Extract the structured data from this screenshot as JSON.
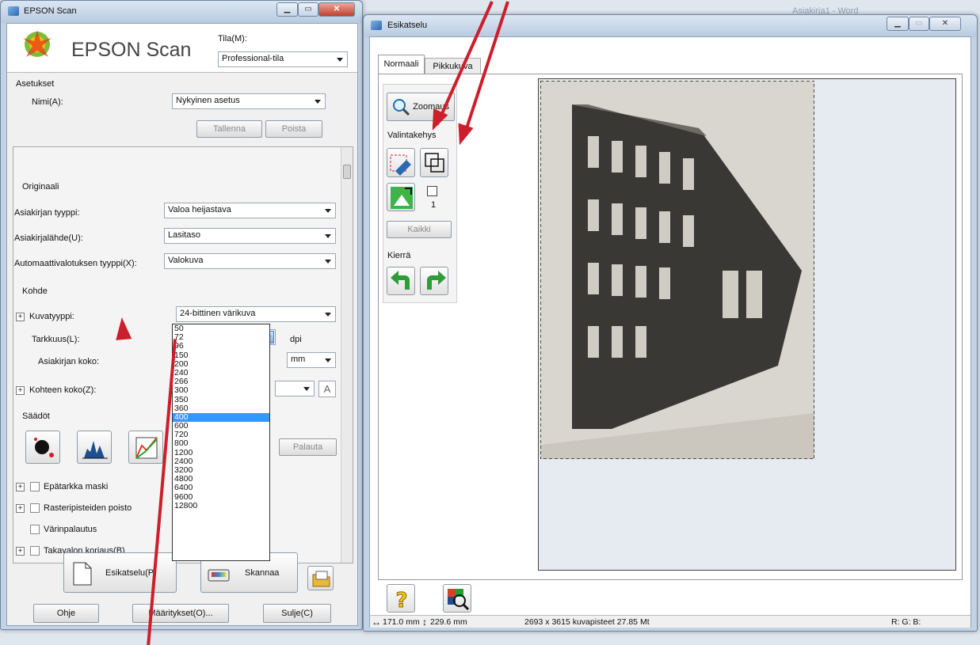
{
  "scan_window": {
    "title": "EPSON Scan",
    "brand": "EPSON Scan",
    "mode_label": "Tila(M):",
    "mode_value": "Professional-tila",
    "settings_group": "Asetukset",
    "name_label": "Nimi(A):",
    "name_value": "Nykyinen asetus",
    "save_button": "Tallenna",
    "delete_button": "Poista",
    "original_heading": "Originaali",
    "doc_type_label": "Asiakirjan tyyppi:",
    "doc_type_value": "Valoa heijastava",
    "doc_source_label": "Asiakirjalähde(U):",
    "doc_source_value": "Lasitaso",
    "auto_exposure_label": "Automaattivalotuksen tyyppi(X):",
    "auto_exposure_value": "Valokuva",
    "target_heading": "Kohde",
    "image_type_label": "Kuvatyyppi:",
    "image_type_value": "24-bittinen värikuva",
    "resolution_label": "Tarkkuus(L):",
    "resolution_value": "400",
    "dpi_unit": "dpi",
    "doc_size_label": "Asiakirjan koko:",
    "unit_value": "mm",
    "target_size_label": "Kohteen koko(Z):",
    "adjustments_heading": "Säädöt",
    "reset_button": "Palauta",
    "unsharp_label": "Epätarkka maski",
    "descreen_label": "Rasteripisteiden poisto",
    "color_restore_label": "Värinpalautus",
    "backlight_label": "Takavalon korjaus(B)",
    "preview_button": "Esikatselu(P)",
    "scan_button": "Skannaa",
    "help_button": "Ohje",
    "config_button": "Määritykset(O)...",
    "close_button": "Sulje(C)",
    "resolution_options": [
      "50",
      "72",
      "96",
      "150",
      "200",
      "240",
      "266",
      "300",
      "350",
      "360",
      "400",
      "600",
      "720",
      "800",
      "1200",
      "2400",
      "3200",
      "4800",
      "6400",
      "9600",
      "12800"
    ],
    "resolution_selected": "400"
  },
  "preview_window": {
    "title": "Esikatselu",
    "tab_normal": "Normaali",
    "tab_thumbnail": "Pikkukuva",
    "zoom_button": "Zoomaus",
    "marquee_group": "Valintakehys",
    "marquee_count": "1",
    "all_button": "Kaikki",
    "rotate_group": "Kierrä",
    "status_size": "171.0 mm",
    "status_height": "229.6 mm",
    "status_pixels": "2693 x 3615 kuvapisteet 27.85 Mt",
    "status_rgb": "R: G: B:"
  },
  "background": {
    "word_title": "Asiakirja1 - Word"
  },
  "colors": {
    "annotation_arrow": "#cc1f2b",
    "selection": "#3399ff",
    "window_frame": "#c4d3e4"
  }
}
